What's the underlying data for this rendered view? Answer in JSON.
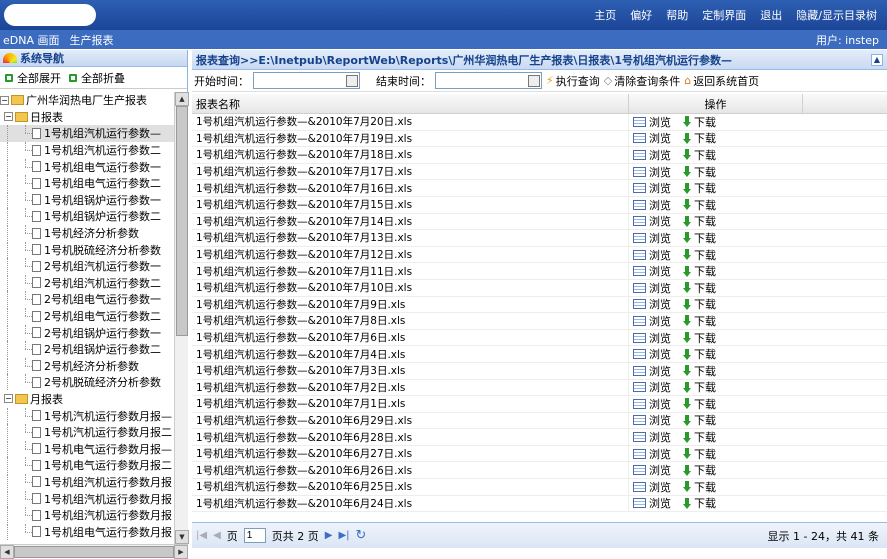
{
  "topnav": [
    "主页",
    "偏好",
    "帮助",
    "定制界面",
    "退出",
    "隐藏/显示目录树"
  ],
  "subbar": {
    "left": [
      "eDNA 画面",
      "生产报表"
    ],
    "user": "用户: instep"
  },
  "sidebar": {
    "title": "系统导航",
    "expand_all": "全部展开",
    "collapse_all": "全部折叠",
    "tree": [
      {
        "label": "广州华润热电厂生产报表",
        "level": 0,
        "type": "folder",
        "toggle": "−"
      },
      {
        "label": "日报表",
        "level": 1,
        "type": "folder",
        "toggle": "−"
      },
      {
        "label": "1号机组汽机运行参数—",
        "level": 2,
        "type": "doc",
        "selected": true
      },
      {
        "label": "1号机组汽机运行参数二",
        "level": 2,
        "type": "doc"
      },
      {
        "label": "1号机组电气运行参数一",
        "level": 2,
        "type": "doc"
      },
      {
        "label": "1号机组电气运行参数二",
        "level": 2,
        "type": "doc"
      },
      {
        "label": "1号机组锅炉运行参数一",
        "level": 2,
        "type": "doc"
      },
      {
        "label": "1号机组锅炉运行参数二",
        "level": 2,
        "type": "doc"
      },
      {
        "label": "1号机经济分析参数",
        "level": 2,
        "type": "doc"
      },
      {
        "label": "1号机脱硫经济分析参数",
        "level": 2,
        "type": "doc"
      },
      {
        "label": "2号机组汽机运行参数一",
        "level": 2,
        "type": "doc"
      },
      {
        "label": "2号机组汽机运行参数二",
        "level": 2,
        "type": "doc"
      },
      {
        "label": "2号机组电气运行参数一",
        "level": 2,
        "type": "doc"
      },
      {
        "label": "2号机组电气运行参数二",
        "level": 2,
        "type": "doc"
      },
      {
        "label": "2号机组锅炉运行参数一",
        "level": 2,
        "type": "doc"
      },
      {
        "label": "2号机组锅炉运行参数二",
        "level": 2,
        "type": "doc"
      },
      {
        "label": "2号机经济分析参数",
        "level": 2,
        "type": "doc"
      },
      {
        "label": "2号机脱硫经济分析参数",
        "level": 2,
        "type": "doc"
      },
      {
        "label": "月报表",
        "level": 1,
        "type": "folder",
        "toggle": "−"
      },
      {
        "label": "1号机汽机运行参数月报—",
        "level": 2,
        "type": "doc"
      },
      {
        "label": "1号机汽机运行参数月报二",
        "level": 2,
        "type": "doc"
      },
      {
        "label": "1号机电气运行参数月报—",
        "level": 2,
        "type": "doc"
      },
      {
        "label": "1号机电气运行参数月报二",
        "level": 2,
        "type": "doc"
      },
      {
        "label": "1号机组汽机运行参数月报",
        "level": 2,
        "type": "doc"
      },
      {
        "label": "1号机组汽机运行参数月报",
        "level": 2,
        "type": "doc"
      },
      {
        "label": "1号机组汽机运行参数月报",
        "level": 2,
        "type": "doc"
      },
      {
        "label": "1号机组电气运行参数月报",
        "level": 2,
        "type": "doc"
      }
    ]
  },
  "main": {
    "breadcrumb": "报表查询>>E:\\Inetpub\\ReportWeb\\Reports\\广州华润热电厂生产报表\\日报表\\1号机组汽机运行参数—",
    "filter": {
      "start_label": "开始时间：",
      "end_label": "结束时间：",
      "query": "执行查询",
      "clear": "清除查询条件",
      "back": "返回系统首页"
    },
    "columns": [
      "报表名称",
      "操作"
    ],
    "actions": {
      "browse": "浏览",
      "download": "下载"
    },
    "rows": [
      "1号机组汽机运行参数—&2010年7月20日.xls",
      "1号机组汽机运行参数—&2010年7月19日.xls",
      "1号机组汽机运行参数—&2010年7月18日.xls",
      "1号机组汽机运行参数—&2010年7月17日.xls",
      "1号机组汽机运行参数—&2010年7月16日.xls",
      "1号机组汽机运行参数—&2010年7月15日.xls",
      "1号机组汽机运行参数—&2010年7月14日.xls",
      "1号机组汽机运行参数—&2010年7月13日.xls",
      "1号机组汽机运行参数—&2010年7月12日.xls",
      "1号机组汽机运行参数—&2010年7月11日.xls",
      "1号机组汽机运行参数—&2010年7月10日.xls",
      "1号机组汽机运行参数—&2010年7月9日.xls",
      "1号机组汽机运行参数—&2010年7月8日.xls",
      "1号机组汽机运行参数—&2010年7月6日.xls",
      "1号机组汽机运行参数—&2010年7月4日.xls",
      "1号机组汽机运行参数—&2010年7月3日.xls",
      "1号机组汽机运行参数—&2010年7月2日.xls",
      "1号机组汽机运行参数—&2010年7月1日.xls",
      "1号机组汽机运行参数—&2010年6月29日.xls",
      "1号机组汽机运行参数—&2010年6月28日.xls",
      "1号机组汽机运行参数—&2010年6月27日.xls",
      "1号机组汽机运行参数—&2010年6月26日.xls",
      "1号机组汽机运行参数—&2010年6月25日.xls",
      "1号机组汽机运行参数—&2010年6月24日.xls"
    ],
    "pager": {
      "page_prefix": "页",
      "page_value": "1",
      "page_suffix": "页共 2 页",
      "info": "显示 1 - 24，共 41 条"
    }
  }
}
